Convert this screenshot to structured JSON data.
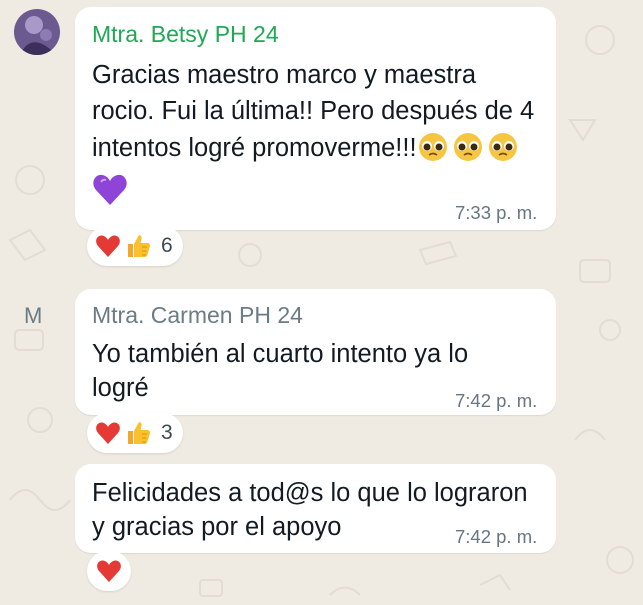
{
  "messages": [
    {
      "sender": "Mtra. Betsy PH 24",
      "sender_color": "#1fa855",
      "text_lines": [
        "Gracias maestro marco y maestra",
        "rocio. Fui la última!! Pero después de 4",
        "intentos logré promoverme!!!"
      ],
      "inline_emoji": "pleading-face-x3",
      "extra_emoji": "purple-heart",
      "time": "7:33 p. m.",
      "reactions": [
        "red-heart",
        "thumbs-up"
      ],
      "reaction_count": "6"
    },
    {
      "avatar_letter": "M",
      "sender": "Mtra. Carmen PH 24",
      "sender_color": "#6b7c85",
      "text_lines": [
        "Yo también al cuarto intento ya lo",
        "logré"
      ],
      "time": "7:42 p. m.",
      "reactions": [
        "red-heart",
        "thumbs-up"
      ],
      "reaction_count": "3"
    },
    {
      "text_lines": [
        "Felicidades a tod@s lo que lo lograron",
        "y gracias por el apoyo"
      ],
      "time": "7:42 p. m.",
      "reactions": [
        "red-heart"
      ]
    }
  ]
}
